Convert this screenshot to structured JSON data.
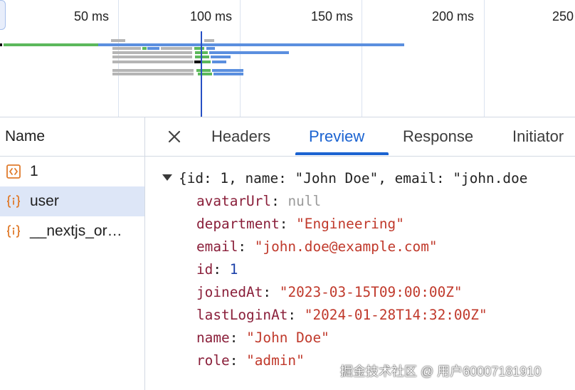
{
  "timeline": {
    "ticks": [
      "50 ms",
      "100 ms",
      "150 ms",
      "200 ms",
      "250"
    ]
  },
  "name_panel": {
    "header": "Name",
    "requests": [
      {
        "label": "1",
        "icon": "document-icon"
      },
      {
        "label": "user",
        "icon": "json-icon"
      },
      {
        "label": "__nextjs_or…",
        "icon": "json-icon"
      }
    ],
    "selected_index": 1
  },
  "detail": {
    "close_glyph": "✕",
    "tabs": [
      "Headers",
      "Preview",
      "Response",
      "Initiator"
    ],
    "active_tab": "Preview",
    "summary": {
      "open": "{",
      "k_id": "id",
      "v_id": "1",
      "k_name": "name",
      "v_name": "\"John Doe\"",
      "k_email": "email",
      "v_email": "\"john.doe"
    },
    "properties": [
      {
        "key": "avatarUrl",
        "value": "null",
        "kind": "null"
      },
      {
        "key": "department",
        "value": "\"Engineering\"",
        "kind": "string"
      },
      {
        "key": "email",
        "value": "\"john.doe@example.com\"",
        "kind": "string"
      },
      {
        "key": "id",
        "value": "1",
        "kind": "number"
      },
      {
        "key": "joinedAt",
        "value": "\"2023-03-15T09:00:00Z\"",
        "kind": "string"
      },
      {
        "key": "lastLoginAt",
        "value": "\"2024-01-28T14:32:00Z\"",
        "kind": "string"
      },
      {
        "key": "name",
        "value": "\"John Doe\"",
        "kind": "string"
      },
      {
        "key": "role",
        "value": "\"admin\"",
        "kind": "string"
      }
    ]
  },
  "watermark": "掘金技术社区 @ 用户60007181910",
  "colors": {
    "accent": "#1b63d1",
    "selected_row": "#dde6f7",
    "json_key": "#8a1f3a",
    "json_string": "#c0392b",
    "json_number": "#1a3fa8",
    "json_null": "#9a9a9a"
  }
}
